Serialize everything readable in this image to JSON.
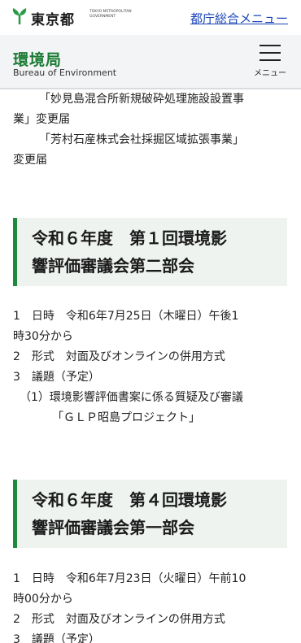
{
  "topbar": {
    "logo_text": "東京都",
    "logo_sub": "TOKYO METROPOLITAN GOVERNMENT",
    "menu_link": "都庁総合メニュー"
  },
  "header": {
    "title": "環境局",
    "subtitle": "Bureau of Environment",
    "menu_label": "メニュー"
  },
  "intro": {
    "line1": "「妙見島混合所新規破砕処理施設設置事",
    "line2": "業」変更届",
    "line3": "「芳村石産株式会社採掘区域拡張事業」",
    "line4": "変更届"
  },
  "sections": [
    {
      "title_line1": "令和６年度　第１回環境影",
      "title_line2": "響評価審議会第二部会",
      "items": [
        "1　日時　令和6年7月25日（木曜日）午後1",
        "時30分から",
        "2　形式　対面及びオンラインの併用方式",
        "3　議題（予定）",
        "（1）環境影響評価書案に係る質疑及び審議",
        "「ＧＬＰ昭島プロジェクト」"
      ]
    },
    {
      "title_line1": "令和６年度　第４回環境影",
      "title_line2": "響評価審議会第一部会",
      "items": [
        "1　日時　令和6年7月23日（火曜日）午前10",
        "時00分から",
        "2　形式　対面及びオンラインの併用方式",
        "3　議題（予定）"
      ]
    }
  ],
  "colors": {
    "brand_green": "#1f8a3c",
    "link_blue": "#1a44b8",
    "heading_bg": "#eef3ef"
  }
}
